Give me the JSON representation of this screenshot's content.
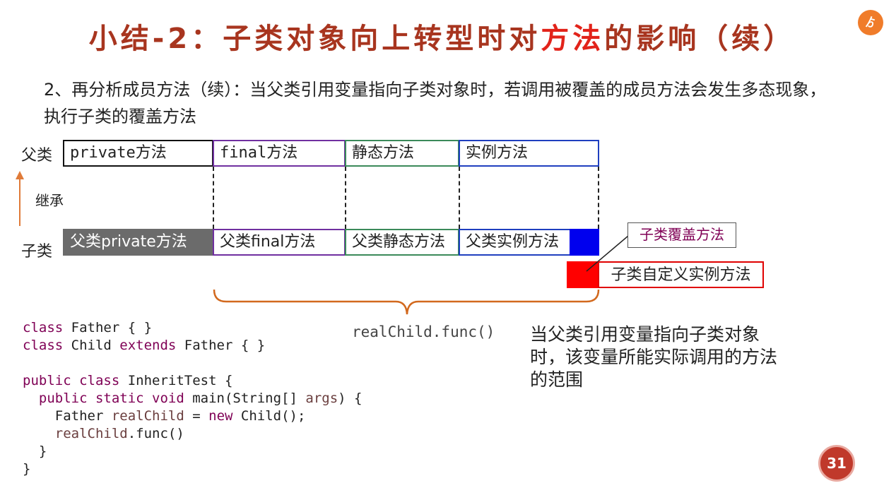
{
  "title": {
    "part1": "小结-2：子类对象向上转型时对",
    "highlight": "方法",
    "part2": "的影响（续）"
  },
  "paragraph": "2、再分析成员方法（续）：当父类引用变量指向子类对象时，若调用被覆盖的成员方法会发生多态现象，执行子类的覆盖方法",
  "labels": {
    "father": "父类",
    "child": "子类",
    "inherit": "继承"
  },
  "father_boxes": [
    "private方法",
    "final方法",
    "静态方法",
    "实例方法"
  ],
  "child_boxes": [
    "父类private方法",
    "父类final方法",
    "父类静态方法",
    "父类实例方法"
  ],
  "callouts": {
    "override": "子类覆盖方法",
    "custom": "子类自定义实例方法"
  },
  "brace_label": "realChild.func()",
  "note": "当父类引用变量指向子类对象时，该变量所能实际调用的方法的范围",
  "code": {
    "l1_kw": "class",
    "l1_rest": " Father { }",
    "l2_kw1": "class",
    "l2_mid": " Child ",
    "l2_kw2": "extends",
    "l2_rest": " Father { }",
    "l4_kw": "public class",
    "l4_rest": " InheritTest {",
    "l5_indent": "  ",
    "l5_kw": "public static void",
    "l5_mid": " main(String[] ",
    "l5_var": "args",
    "l5_rest": ") {",
    "l6_pre": "    Father ",
    "l6_var": "realChild",
    "l6_mid": " = ",
    "l6_kw": "new",
    "l6_rest": " Child();",
    "l7_indent": "    ",
    "l7_var": "realChild",
    "l7_rest": ".func()",
    "l8": "  }",
    "l9": "}"
  },
  "page_number": "31",
  "colors": {
    "title": "#a8351f",
    "highlight": "#e2231a",
    "brace": "#d2691e",
    "arrow": "#e07b39",
    "keyword": "#7f0055"
  }
}
